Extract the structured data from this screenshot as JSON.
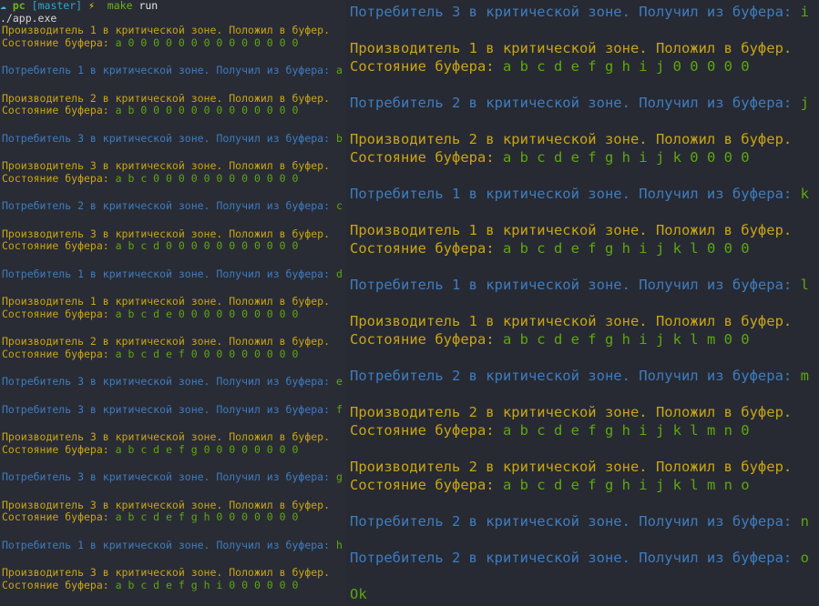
{
  "colors": {
    "background": "#282b34",
    "producer": "#c9a515",
    "consumer": "#3e7cc0",
    "value": "#5ea70f"
  },
  "left": {
    "prompt": {
      "icon": "cloud-icon",
      "host": "pc",
      "branch": "[master]",
      "bolt_icon": "lightning-icon",
      "command": "make",
      "argument": "run"
    },
    "exec_line": "./app.exe",
    "entries": [
      {
        "kind": "producer",
        "text": "Производитель 1 в критической зоне. Положил в буфер.",
        "label": "Состояние буфера:",
        "value": "a 0 0 0 0 0 0 0 0 0 0 0 0 0 0"
      },
      {
        "kind": "consumer",
        "text": "Потребитель 1 в критической зоне. Получил из буфера:",
        "value": "a"
      },
      {
        "kind": "producer",
        "text": "Производитель 2 в критической зоне. Положил в буфер.",
        "label": "Состояние буфера:",
        "value": "a b 0 0 0 0 0 0 0 0 0 0 0 0 0"
      },
      {
        "kind": "consumer",
        "text": "Потребитель 3 в критической зоне. Получил из буфера:",
        "value": "b"
      },
      {
        "kind": "producer",
        "text": "Производитель 3 в критической зоне. Положил в буфер.",
        "label": "Состояние буфера:",
        "value": "a b c 0 0 0 0 0 0 0 0 0 0 0 0"
      },
      {
        "kind": "consumer",
        "text": "Потребитель 2 в критической зоне. Получил из буфера:",
        "value": "c"
      },
      {
        "kind": "producer",
        "text": "Производитель 3 в критической зоне. Положил в буфер.",
        "label": "Состояние буфера:",
        "value": "a b c d 0 0 0 0 0 0 0 0 0 0 0"
      },
      {
        "kind": "consumer",
        "text": "Потребитель 1 в критической зоне. Получил из буфера:",
        "value": "d"
      },
      {
        "kind": "producer",
        "text": "Производитель 1 в критической зоне. Положил в буфер.",
        "label": "Состояние буфера:",
        "value": "a b c d e 0 0 0 0 0 0 0 0 0 0"
      },
      {
        "kind": "producer",
        "text": "Производитель 2 в критической зоне. Положил в буфер.",
        "label": "Состояние буфера:",
        "value": "a b c d e f 0 0 0 0 0 0 0 0 0"
      },
      {
        "kind": "consumer",
        "text": "Потребитель 3 в критической зоне. Получил из буфера:",
        "value": "e"
      },
      {
        "kind": "consumer",
        "text": "Потребитель 3 в критической зоне. Получил из буфера:",
        "value": "f"
      },
      {
        "kind": "producer",
        "text": "Производитель 3 в критической зоне. Положил в буфер.",
        "label": "Состояние буфера:",
        "value": "a b c d e f g 0 0 0 0 0 0 0 0"
      },
      {
        "kind": "consumer",
        "text": "Потребитель 3 в критической зоне. Получил из буфера:",
        "value": "g"
      },
      {
        "kind": "producer",
        "text": "Производитель 3 в критической зоне. Положил в буфер.",
        "label": "Состояние буфера:",
        "value": "a b c d e f g h 0 0 0 0 0 0 0"
      },
      {
        "kind": "consumer",
        "text": "Потребитель 1 в критической зоне. Получил из буфера:",
        "value": "h"
      },
      {
        "kind": "producer",
        "text": "Производитель 3 в критической зоне. Положил в буфер.",
        "label": "Состояние буфера:",
        "value": "a b c d e f g h i 0 0 0 0 0 0"
      }
    ]
  },
  "right": {
    "entries": [
      {
        "kind": "consumer",
        "text": "Потребитель 3 в критической зоне. Получил из буфера:",
        "value": "i"
      },
      {
        "kind": "producer",
        "text": "Производитель 1 в критической зоне. Положил в буфер.",
        "label": "Состояние буфера:",
        "value": "a b c d e f g h i j 0 0 0 0 0"
      },
      {
        "kind": "consumer",
        "text": "Потребитель 2 в критической зоне. Получил из буфера:",
        "value": "j"
      },
      {
        "kind": "producer",
        "text": "Производитель 2 в критической зоне. Положил в буфер.",
        "label": "Состояние буфера:",
        "value": "a b c d e f g h i j k 0 0 0 0"
      },
      {
        "kind": "consumer",
        "text": "Потребитель 1 в критической зоне. Получил из буфера:",
        "value": "k"
      },
      {
        "kind": "producer",
        "text": "Производитель 1 в критической зоне. Положил в буфер.",
        "label": "Состояние буфера:",
        "value": "a b c d e f g h i j k l 0 0 0"
      },
      {
        "kind": "consumer",
        "text": "Потребитель 1 в критической зоне. Получил из буфера:",
        "value": "l"
      },
      {
        "kind": "producer",
        "text": "Производитель 1 в критической зоне. Положил в буфер.",
        "label": "Состояние буфера:",
        "value": "a b c d e f g h i j k l m 0 0"
      },
      {
        "kind": "consumer",
        "text": "Потребитель 2 в критической зоне. Получил из буфера:",
        "value": "m"
      },
      {
        "kind": "producer",
        "text": "Производитель 2 в критической зоне. Положил в буфер.",
        "label": "Состояние буфера:",
        "value": "a b c d e f g h i j k l m n 0"
      },
      {
        "kind": "producer",
        "text": "Производитель 2 в критической зоне. Положил в буфер.",
        "label": "Состояние буфера:",
        "value": "a b c d e f g h i j k l m n o"
      },
      {
        "kind": "consumer",
        "text": "Потребитель 2 в критической зоне. Получил из буфера:",
        "value": "n"
      },
      {
        "kind": "consumer",
        "text": "Потребитель 2 в критической зоне. Получил из буфера:",
        "value": "o"
      }
    ],
    "final": "Ok"
  }
}
